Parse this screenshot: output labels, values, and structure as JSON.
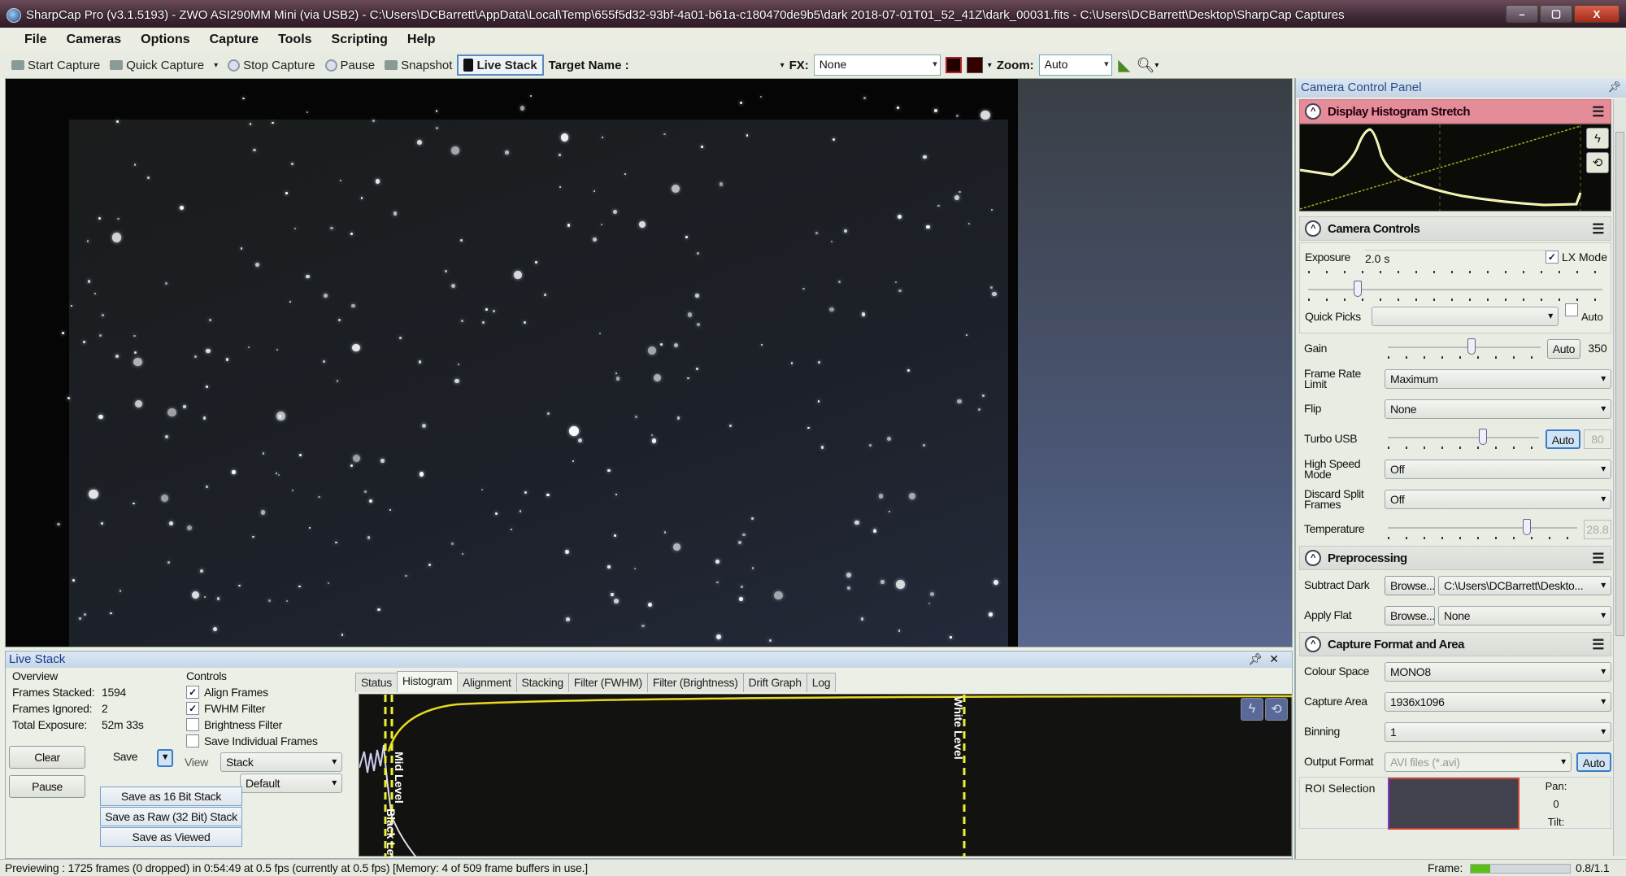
{
  "window": {
    "title": "SharpCap Pro (v3.1.5193) - ZWO ASI290MM Mini (via USB2) - C:\\Users\\DCBarrett\\AppData\\Local\\Temp\\655f5d32-93bf-4a01-b61a-c180470de9b5\\dark 2018-07-01T01_52_41Z\\dark_00031.fits - C:\\Users\\DCBarrett\\Desktop\\SharpCap Captures",
    "minimize": "–",
    "maximize": "▢",
    "close": "X"
  },
  "menu": [
    "File",
    "Cameras",
    "Options",
    "Capture",
    "Tools",
    "Scripting",
    "Help"
  ],
  "toolbar": {
    "start_capture": "Start Capture",
    "quick_capture": "Quick Capture",
    "stop_capture": "Stop Capture",
    "pause": "Pause",
    "snapshot": "Snapshot",
    "live_stack": "Live Stack",
    "target_name_label": "Target Name :",
    "fx_label": "FX:",
    "fx_value": "None",
    "zoom_label": "Zoom:",
    "zoom_value": "Auto"
  },
  "camera_panel": {
    "title": "Camera Control Panel",
    "histogram_section": "Display Histogram Stretch",
    "camera_controls_section": "Camera Controls",
    "exposure_label": "Exposure",
    "exposure_value": "2.0 s",
    "lx_mode_label": "LX Mode",
    "lx_mode_checked": true,
    "quick_picks_label": "Quick Picks",
    "quick_picks_value": "",
    "auto_label": "Auto",
    "gain_label": "Gain",
    "gain_auto": "Auto",
    "gain_value": "350",
    "frame_rate_label": "Frame Rate Limit",
    "frame_rate_value": "Maximum",
    "flip_label": "Flip",
    "flip_value": "None",
    "turbo_usb_label": "Turbo USB",
    "turbo_usb_auto": "Auto",
    "turbo_usb_value": "80",
    "high_speed_label": "High Speed Mode",
    "high_speed_value": "Off",
    "discard_split_label": "Discard Split Frames",
    "discard_split_value": "Off",
    "temperature_label": "Temperature",
    "temperature_value": "28.8",
    "preprocessing_section": "Preprocessing",
    "subtract_dark_label": "Subtract Dark",
    "subtract_dark_browse": "Browse...",
    "subtract_dark_value": "C:\\Users\\DCBarrett\\Deskto...",
    "apply_flat_label": "Apply Flat",
    "apply_flat_browse": "Browse...",
    "apply_flat_value": "None",
    "capture_format_section": "Capture Format and Area",
    "colour_space_label": "Colour Space",
    "colour_space_value": "MONO8",
    "capture_area_label": "Capture Area",
    "capture_area_value": "1936x1096",
    "binning_label": "Binning",
    "binning_value": "1",
    "output_format_label": "Output Format",
    "output_format_value": "AVI files (*.avi)",
    "output_format_auto": "Auto",
    "roi_label": "ROI Selection",
    "pan_label": "Pan:",
    "pan_value": "0",
    "tilt_label": "Tilt:"
  },
  "live_stack": {
    "title": "Live Stack",
    "overview_label": "Overview",
    "frames_stacked_label": "Frames Stacked:",
    "frames_stacked_value": "1594",
    "frames_ignored_label": "Frames Ignored:",
    "frames_ignored_value": "2",
    "total_exposure_label": "Total Exposure:",
    "total_exposure_value": "52m 33s",
    "clear": "Clear",
    "pause": "Pause",
    "save": "Save",
    "save_menu": [
      "Save as 16 Bit Stack",
      "Save as Raw (32 Bit) Stack",
      "Save as Viewed"
    ],
    "controls_label": "Controls",
    "controls": [
      {
        "label": "Align Frames",
        "checked": true
      },
      {
        "label": "FWHM Filter",
        "checked": true
      },
      {
        "label": "Brightness Filter",
        "checked": false
      },
      {
        "label": "Save Individual Frames",
        "checked": false
      }
    ],
    "view_label": "View",
    "view_value": "Stack",
    "second_value": "Default",
    "tabs": [
      "Status",
      "Histogram",
      "Alignment",
      "Stacking",
      "Filter (FWHM)",
      "Filter (Brightness)",
      "Drift Graph",
      "Log"
    ],
    "active_tab": "Histogram",
    "mid_level_label": "Mid Level",
    "black_level_label": "Black Level",
    "white_level_label": "White Level"
  },
  "status_bar": {
    "text": "Previewing : 1725 frames (0 dropped) in 0:54:49 at 0.5 fps  (currently at 0.5 fps) [Memory: 4 of 509 frame buffers in use.]",
    "frame_label": "Frame:",
    "frame_value": "0.8/1.1",
    "frame_fraction": 0.2
  }
}
